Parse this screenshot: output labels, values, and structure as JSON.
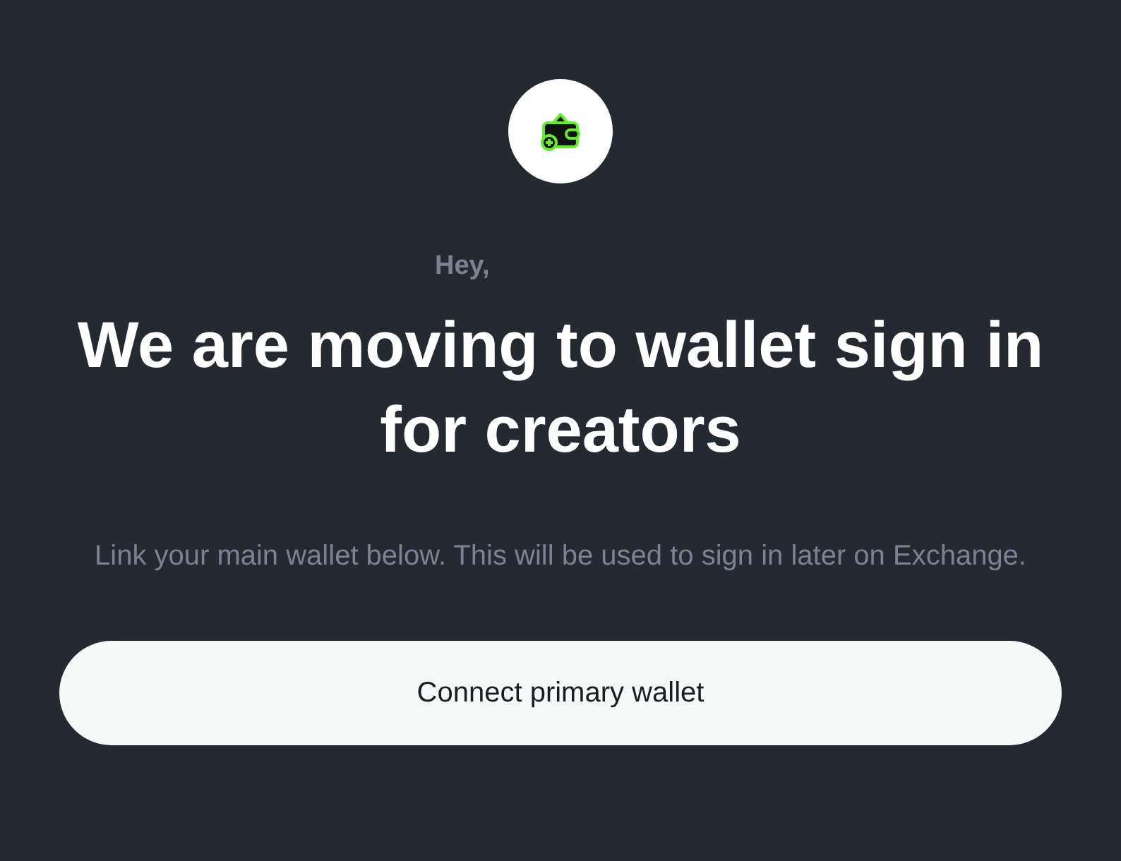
{
  "greeting": "Hey,",
  "title": "We are moving to wallet sign in for creators",
  "description": "Link your main wallet below. This will be used to sign in later on Exchange.",
  "button": "Connect primary wallet"
}
